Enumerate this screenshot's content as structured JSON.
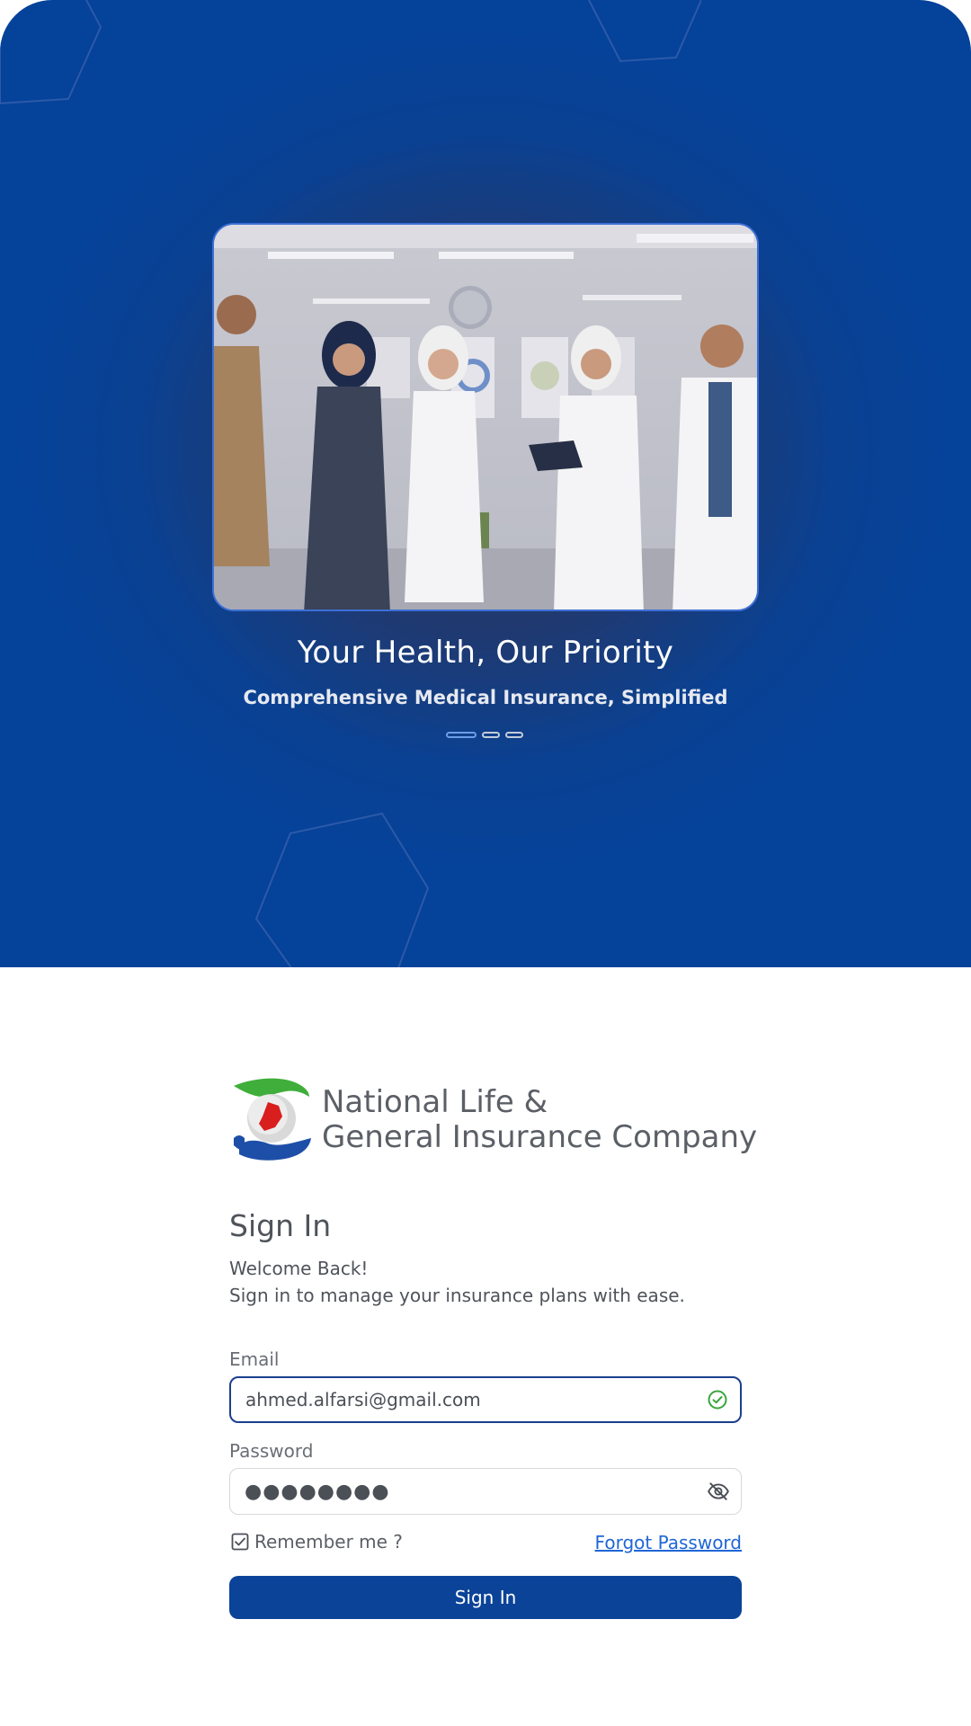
{
  "hero": {
    "title": "Your Health, Our Priority",
    "subtitle": "Comprehensive Medical Insurance, Simplified",
    "slides": 3,
    "active_slide": 1
  },
  "company": {
    "name_line1": "National Life &",
    "name_line2": "General Insurance Company"
  },
  "signin": {
    "heading": "Sign In",
    "welcome": "Welcome Back!",
    "tagline": "Sign in to manage your insurance plans with ease."
  },
  "form": {
    "email_label": "Email",
    "email_value": "ahmed.alfarsi@gmail.com",
    "password_label": "Password",
    "password_mask": "●●●●●●●●",
    "remember_label": "Remember me ?",
    "remember_checked": true,
    "forgot_label": "Forgot Password",
    "submit_label": "Sign In"
  },
  "icons": {
    "email_status": "check-circle-icon",
    "password_toggle": "eye-off-icon",
    "remember": "checkbox-icon"
  },
  "colors": {
    "primary": "#0b4398",
    "link": "#1f66d6",
    "success": "#3aa53a"
  }
}
